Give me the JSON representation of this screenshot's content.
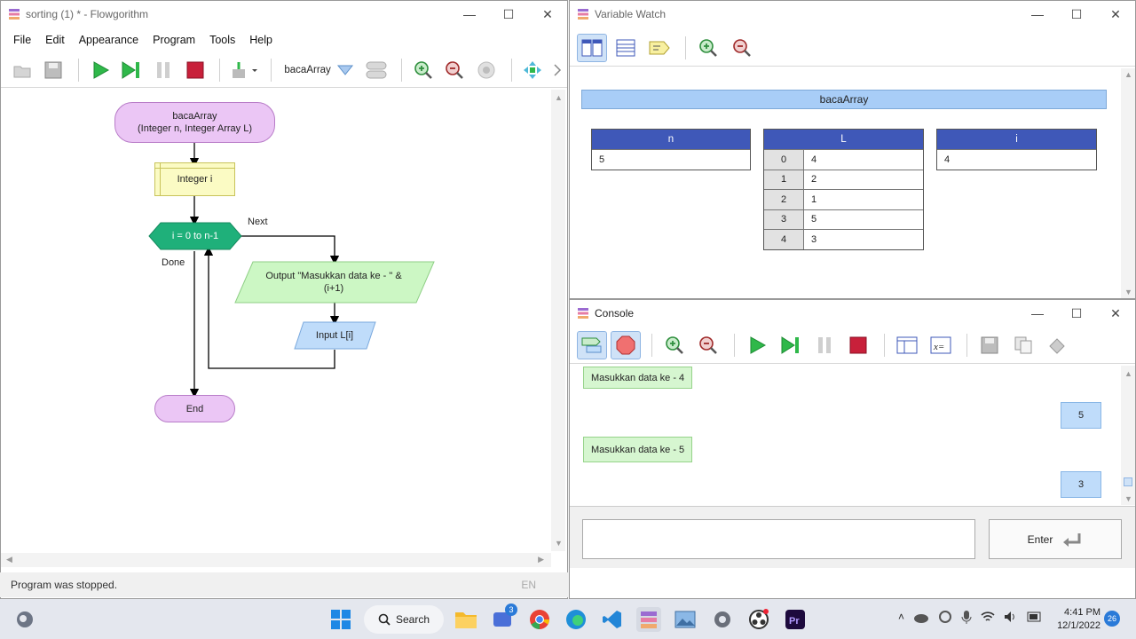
{
  "flowgorithm": {
    "title": "sorting (1) * - Flowgorithm",
    "menu": [
      "File",
      "Edit",
      "Appearance",
      "Program",
      "Tools",
      "Help"
    ],
    "function_selector": "bacaArray",
    "status": "Program was stopped.",
    "lang": "EN",
    "chart": {
      "start_line1": "bacaArray",
      "start_line2": "(Integer n, Integer Array L)",
      "declare": "Integer i",
      "loop": "i = 0 to n-1",
      "next_label": "Next",
      "done_label": "Done",
      "output_line1": "Output \"Masukkan data ke - \" &",
      "output_line2": "(i+1)",
      "input": "Input L[i]",
      "end": "End"
    }
  },
  "variable_watch": {
    "title": "Variable Watch",
    "function_name": "bacaArray",
    "vars": {
      "n": {
        "name": "n",
        "value": "5"
      },
      "L": {
        "name": "L",
        "rows": [
          {
            "index": "0",
            "value": "4"
          },
          {
            "index": "1",
            "value": "2"
          },
          {
            "index": "2",
            "value": "1"
          },
          {
            "index": "3",
            "value": "5"
          },
          {
            "index": "4",
            "value": "3"
          }
        ]
      },
      "i": {
        "name": "i",
        "value": "4"
      }
    }
  },
  "console": {
    "title": "Console",
    "messages": [
      {
        "type": "output",
        "text": "Masukkan data ke - 4"
      },
      {
        "type": "input",
        "text": "5"
      },
      {
        "type": "output",
        "text": "Masukkan data ke - 5"
      },
      {
        "type": "input",
        "text": "3"
      }
    ],
    "input_value": "",
    "enter_label": "Enter"
  },
  "taskbar": {
    "search_label": "Search",
    "badge_count": "3",
    "time": "4:41 PM",
    "date": "12/1/2022",
    "notifications": "26"
  },
  "colors": {
    "start_oval": "#ebc6f5",
    "loop": "#1fb07a",
    "output": "#ccf7c4",
    "input": "#bfdcfa",
    "watch_header": "#3f58b8"
  }
}
